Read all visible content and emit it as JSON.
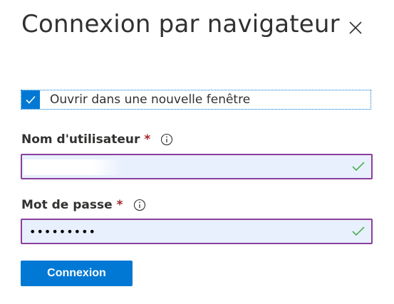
{
  "dialog": {
    "title": "Connexion par navigateur"
  },
  "checkbox": {
    "label": "Ouvrir dans une nouvelle fenêtre",
    "checked": true
  },
  "username": {
    "label": "Nom d'utilisateur",
    "required_mark": "*",
    "value": ""
  },
  "password": {
    "label": "Mot de passe",
    "required_mark": "*",
    "value": "•••••••••"
  },
  "submit": {
    "label": "Connexion"
  },
  "colors": {
    "accent": "#0078d4",
    "required": "#a4262c",
    "field_border": "#8a3f9c",
    "field_fill": "#e8f0fe",
    "valid_check": "#4caf50"
  },
  "icons": {
    "close": "close-icon",
    "checkbox": "checkmark-icon",
    "info": "info-icon",
    "valid": "valid-check-icon"
  }
}
